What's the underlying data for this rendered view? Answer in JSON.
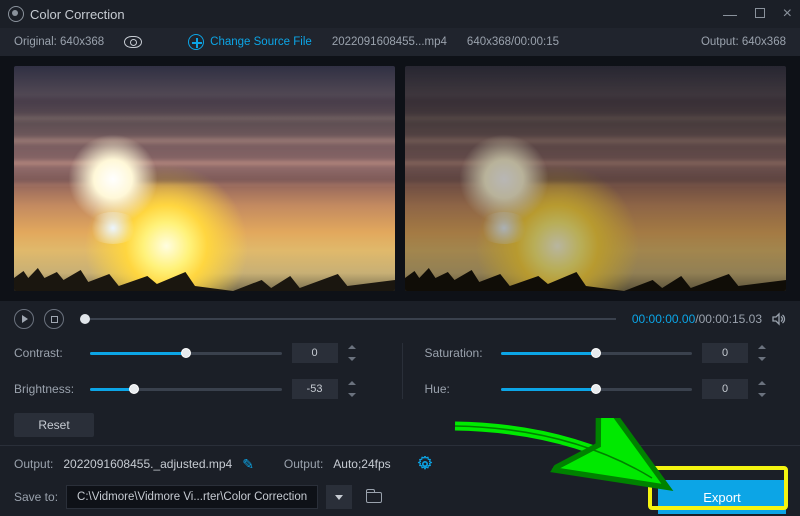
{
  "window": {
    "title": "Color Correction"
  },
  "source_bar": {
    "original_label": "Original:",
    "original_dim": "640x368",
    "change_src_label": "Change Source File",
    "filename": "2022091608455...mp4",
    "dim_time": "640x368/00:00:15",
    "output_label": "Output:",
    "output_dim": "640x368"
  },
  "timeline": {
    "current": "00:00:00.00",
    "sep": "/",
    "total": "00:00:15.03"
  },
  "sliders": {
    "contrast": {
      "label": "Contrast:",
      "value": "0",
      "percent": 50
    },
    "brightness": {
      "label": "Brightness:",
      "value": "-53",
      "percent": 23
    },
    "saturation": {
      "label": "Saturation:",
      "value": "0",
      "percent": 50
    },
    "hue": {
      "label": "Hue:",
      "value": "0",
      "percent": 50
    }
  },
  "reset": {
    "label": "Reset"
  },
  "output_line": {
    "output_label1": "Output:",
    "output_file": "2022091608455._adjusted.mp4",
    "output_label2": "Output:",
    "output_fmt": "Auto;24fps"
  },
  "save_line": {
    "saveto_label": "Save to:",
    "path": "C:\\Vidmore\\Vidmore Vi...rter\\Color Correction"
  },
  "export": {
    "label": "Export"
  }
}
